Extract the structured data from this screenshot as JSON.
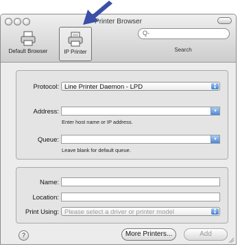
{
  "window": {
    "title": "Printer Browser"
  },
  "toolbar": {
    "default_browser_label": "Default Browser",
    "ip_printer_label": "IP Printer",
    "search_placeholder": "Q-",
    "search_label": "Search"
  },
  "protocol": {
    "label": "Protocol:",
    "value": "Line Printer Daemon - LPD"
  },
  "address": {
    "label": "Address:",
    "value": "",
    "hint": "Enter host name or IP address."
  },
  "queue": {
    "label": "Queue:",
    "value": "",
    "hint": "Leave blank for default queue."
  },
  "name": {
    "label": "Name:",
    "value": ""
  },
  "location": {
    "label": "Location:",
    "value": ""
  },
  "print_using": {
    "label": "Print Using:",
    "value": "Please select a driver or printer model"
  },
  "buttons": {
    "help": "?",
    "more_printers": "More Printers...",
    "add": "Add"
  },
  "colors": {
    "accent": "#3d7fd6",
    "annotation_arrow": "#3b4fa8"
  }
}
